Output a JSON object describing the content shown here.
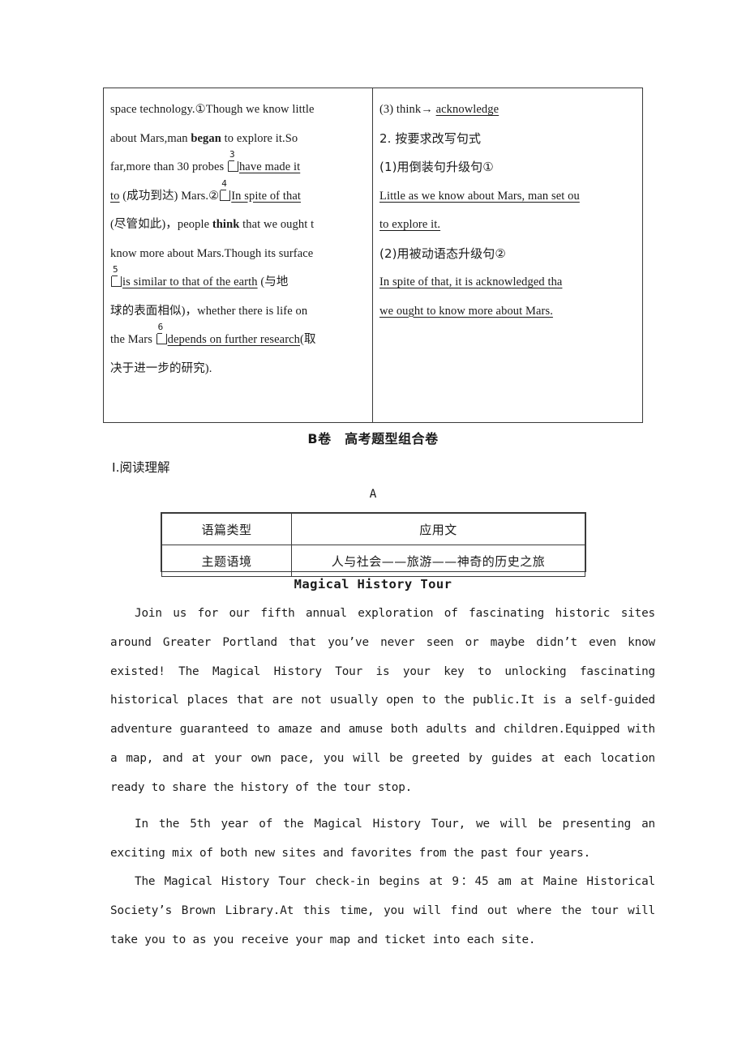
{
  "exercise_table": {
    "left_column": {
      "lines": [
        {
          "id": "l1",
          "segments": [
            {
              "text": "space technology.①Though we know little",
              "style": "plain"
            }
          ]
        },
        {
          "id": "l2",
          "segments": [
            {
              "text": "about Mars,man ",
              "style": "plain"
            },
            {
              "text": "began",
              "style": "bold"
            },
            {
              "text": " to explore it.So",
              "style": "plain"
            }
          ]
        },
        {
          "id": "l3",
          "segments": [
            {
              "text": "far,more than 30 probes  ",
              "style": "plain"
            },
            {
              "text": "3",
              "style": "blank"
            },
            {
              "text": "have made it",
              "style": "underline"
            }
          ]
        },
        {
          "id": "l4",
          "segments": [
            {
              "text": "to",
              "style": "underline"
            },
            {
              "text": " (成功到达) Mars.②",
              "style": "plain"
            },
            {
              "text": "4",
              "style": "blank"
            },
            {
              "text": "In spite of that",
              "style": "underline"
            }
          ]
        },
        {
          "id": "l5",
          "segments": [
            {
              "text": "(尽管如此)，people ",
              "style": "plain"
            },
            {
              "text": "think",
              "style": "bold"
            },
            {
              "text": " that we ought t",
              "style": "plain"
            }
          ]
        },
        {
          "id": "l6",
          "segments": [
            {
              "text": "know more about Mars.Though its surface",
              "style": "plain"
            }
          ]
        },
        {
          "id": "l7",
          "segments": [
            {
              "text": "5",
              "style": "blank"
            },
            {
              "text": "is similar to that of the earth",
              "style": "underline"
            },
            {
              "text": " (与地",
              "style": "plain"
            }
          ]
        },
        {
          "id": "l8",
          "segments": [
            {
              "text": "球的表面相似)，whether there is life on",
              "style": "plain"
            }
          ]
        },
        {
          "id": "l9",
          "segments": [
            {
              "text": "the Mars ",
              "style": "plain"
            },
            {
              "text": "6",
              "style": "blank"
            },
            {
              "text": "depends on further research",
              "style": "underline"
            },
            {
              "text": "(取",
              "style": "plain"
            }
          ]
        },
        {
          "id": "l10",
          "segments": [
            {
              "text": "决于进一步的研究).",
              "style": "plain"
            }
          ]
        }
      ]
    },
    "right_column": {
      "lines": [
        {
          "id": "r1",
          "segments": [
            {
              "text": "(3) think→ ",
              "style": "plain"
            },
            {
              "text": "acknowledge",
              "style": "underline"
            }
          ]
        },
        {
          "id": "r2",
          "segments": [
            {
              "text": "2. 按要求改写句式",
              "style": "cn"
            }
          ]
        },
        {
          "id": "r3",
          "segments": [
            {
              "text": "(1)用倒装句升级句①",
              "style": "cn"
            }
          ]
        },
        {
          "id": "r4",
          "segments": [
            {
              "text": "Little as we know about Mars, man set ou",
              "style": "underline"
            }
          ]
        },
        {
          "id": "r5",
          "segments": [
            {
              "text": "to explore it.",
              "style": "underline"
            }
          ]
        },
        {
          "id": "r6",
          "segments": [
            {
              "text": "(2)用被动语态升级句②",
              "style": "cn"
            }
          ]
        },
        {
          "id": "r7",
          "segments": [
            {
              "text": "In spite of that, it is acknowledged tha",
              "style": "underline"
            }
          ]
        },
        {
          "id": "r8",
          "segments": [
            {
              "text": "we ought to know more about Mars.",
              "style": "underline"
            }
          ]
        }
      ]
    }
  },
  "section": {
    "b_juan_heading": "B卷　高考题型组合卷",
    "reading_label": "Ⅰ.阅读理解",
    "passage_letter": "A"
  },
  "info_table": {
    "rows": [
      {
        "label": "语篇类型",
        "value": "应用文"
      },
      {
        "label": "主题语境",
        "value": "人与社会——旅游——神奇的历史之旅"
      }
    ]
  },
  "passage": {
    "title": "Magical History Tour",
    "paragraphs": [
      "Join us for our fifth annual exploration of fascinating historic sites around Greater Portland that you’ve never seen or maybe didn’t even know existed! The Magical History Tour is your key to unlocking fascinating historical places that are not usually open to the public.It is a self-guided adventure guaranteed to amaze and amuse both adults and children.Equipped with a map, and at your own pace, you will be greeted by guides at each location ready to share the history of the tour stop.",
      "In the 5th year of the Magical History Tour, we will be presenting an exciting mix of both new sites and favorites from the past four years.",
      "The Magical History Tour check-in begins at 9：45 am at Maine Historical Society’s Brown Library.At this time, you will find out where the tour will take you to as you receive your map and ticket into each site."
    ]
  }
}
